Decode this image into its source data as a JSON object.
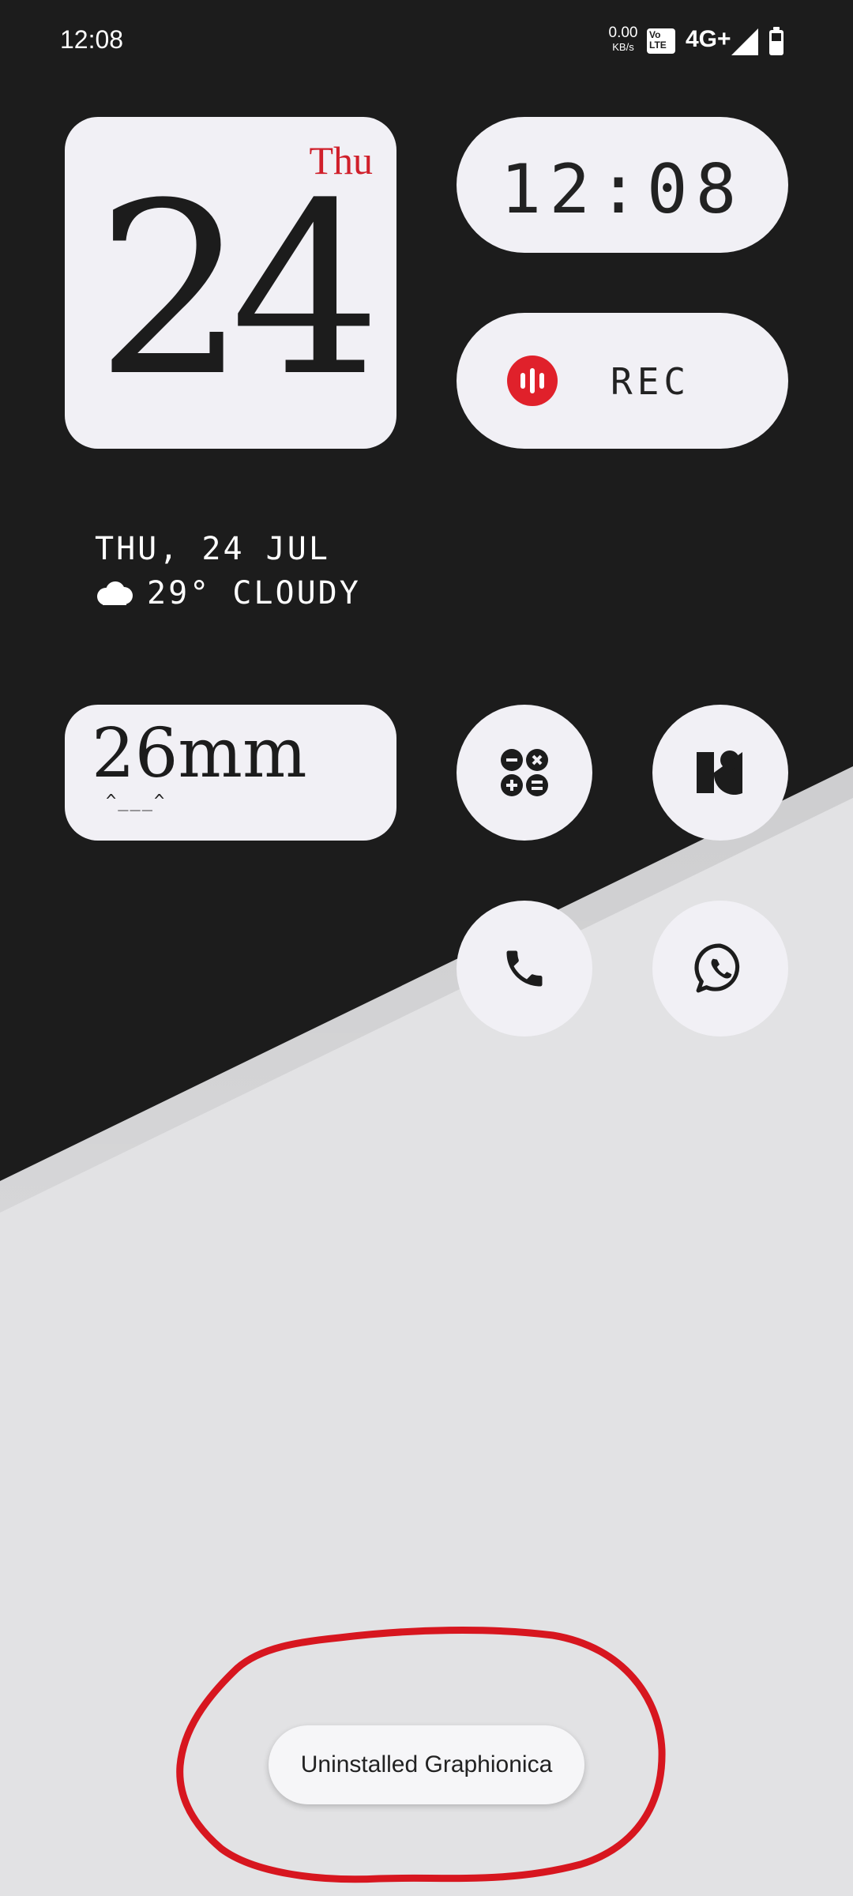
{
  "status_bar": {
    "time": "12:08",
    "data_speed_value": "0.00",
    "data_speed_unit": "KB/s",
    "volte_line1": "Vo",
    "volte_line2": "LTE",
    "network": "4G+"
  },
  "widgets": {
    "date_day_of_week": "Thu",
    "date_day": "24",
    "clock_time": "12:08",
    "recorder_label": "REC",
    "info_date": "THU, 24 JUL",
    "info_weather": "29° CLOUDY",
    "focal_value": "26mm",
    "focal_face": "^___^"
  },
  "apps": {
    "calculator": "calculator-icon",
    "nothing": "nothing-x-icon",
    "phone": "phone-icon",
    "whatsapp": "whatsapp-icon"
  },
  "toast": {
    "message": "Uninstalled Graphionica"
  },
  "colors": {
    "dark_bg": "#1c1c1c",
    "light_bg": "#e2e2e4",
    "widget_bg": "#f1f0f5",
    "accent_red": "#d01f2a",
    "annotation_red": "#d7161f"
  }
}
